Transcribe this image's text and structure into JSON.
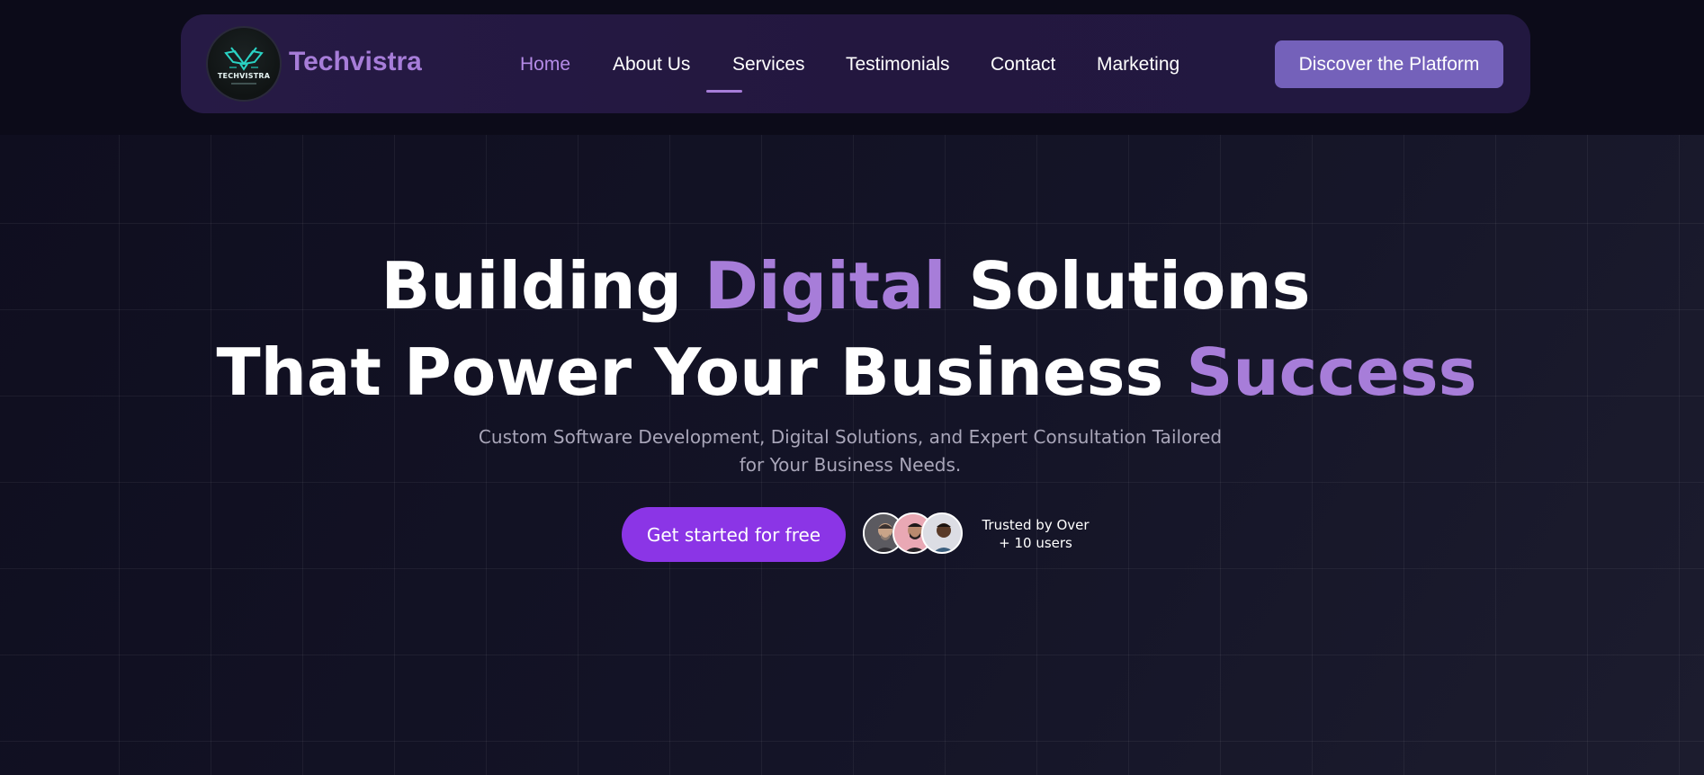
{
  "brand": {
    "name": "Techvistra",
    "logo_text": "TECHVISTRA",
    "accent_color": "#a77dd9"
  },
  "nav": {
    "items": [
      {
        "label": "Home",
        "active": true
      },
      {
        "label": "About Us",
        "active": false
      },
      {
        "label": "Services",
        "active": false
      },
      {
        "label": "Testimonials",
        "active": false
      },
      {
        "label": "Contact",
        "active": false
      },
      {
        "label": "Marketing",
        "active": false
      }
    ],
    "cta_label": "Discover the Platform",
    "cta_color": "#7461ba"
  },
  "hero": {
    "line1": {
      "before": "Building ",
      "accent": "Digital",
      "after": " Solutions"
    },
    "line2": {
      "before": "That Power Your Business ",
      "accent": "Success"
    },
    "subtitle": "Custom Software Development, Digital Solutions, and Expert Consultation Tailored for Your Business Needs.",
    "cta_label": "Get started for free",
    "cta_color": "#8b35e6",
    "trusted_line1": "Trusted by Over",
    "trusted_line2": "+ 10 users",
    "avatars": [
      "user-avatar-1",
      "user-avatar-2",
      "user-avatar-3"
    ]
  }
}
